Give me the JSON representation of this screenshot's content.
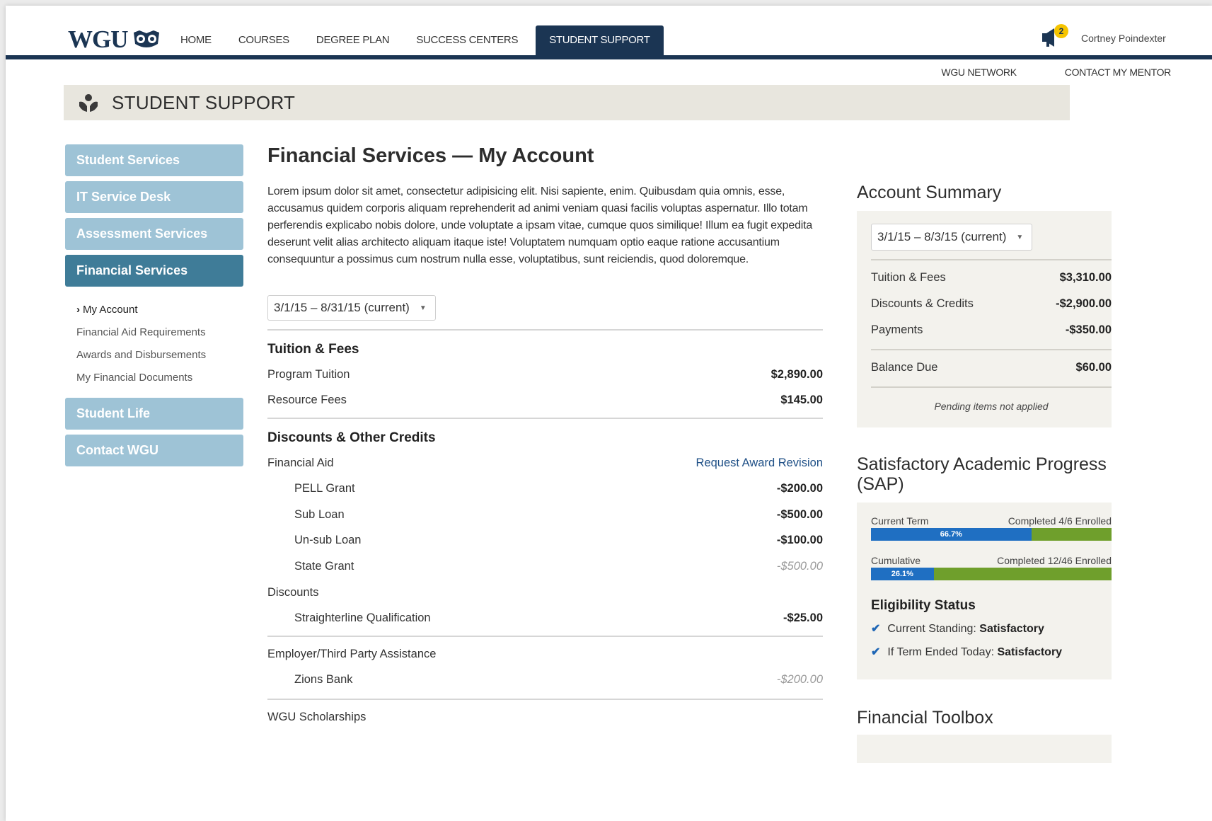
{
  "brand": {
    "logo_text": "WGU"
  },
  "nav": {
    "items": [
      "Home",
      "Courses",
      "Degree Plan",
      "Success Centers"
    ],
    "active": "Student Support"
  },
  "user": {
    "name": "Cortney Poindexter",
    "notification_count": "2"
  },
  "util_links": [
    "WGU Network",
    "Contact My Mentor"
  ],
  "section": {
    "title": "STUDENT SUPPORT"
  },
  "sidebar": {
    "buttons_top": [
      "Student Services",
      "IT Service Desk",
      "Assessment Services"
    ],
    "active": "Financial Services",
    "sub_items": [
      {
        "label": "My Account",
        "current": true
      },
      {
        "label": "Financial Aid Requirements"
      },
      {
        "label": "Awards and Disbursements"
      },
      {
        "label": "My Financial Documents"
      }
    ],
    "buttons_bottom": [
      "Student Life",
      "Contact WGU"
    ]
  },
  "main": {
    "title": "Financial Services — My Account",
    "intro": "Lorem ipsum dolor sit amet, consectetur adipisicing elit. Nisi sapiente, enim. Quibusdam quia omnis, esse, accusamus quidem corporis aliquam reprehenderit ad animi veniam quasi facilis voluptas aspernatur. Illo totam perferendis explicabo nobis dolore, unde voluptate a ipsam vitae, cumque quos similique! Illum ea fugit expedita deserunt velit alias architecto aliquam itaque iste! Voluptatem numquam optio eaque ratione accusantium consequuntur a possimus cum nostrum nulla esse, voluptatibus, sunt reiciendis, quod doloremque.",
    "term_select": "3/1/15 – 8/31/15 (current)",
    "tuition": {
      "title": "Tuition & Fees",
      "rows": [
        {
          "label": "Program Tuition",
          "amount": "$2,890.00"
        },
        {
          "label": "Resource Fees",
          "amount": "$145.00"
        }
      ]
    },
    "discounts": {
      "title": "Discounts & Other Credits",
      "financial_aid_label": "Financial Aid",
      "revision_link": "Request Award Revision",
      "aid_rows": [
        {
          "label": "PELL Grant",
          "amount": "-$200.00"
        },
        {
          "label": "Sub Loan",
          "amount": "-$500.00"
        },
        {
          "label": "Un-sub Loan",
          "amount": "-$100.00"
        },
        {
          "label": "State Grant",
          "amount": "-$500.00",
          "pending": true
        }
      ],
      "discounts_label": "Discounts",
      "discount_rows": [
        {
          "label": "Straighterline Qualification",
          "amount": "-$25.00"
        }
      ]
    },
    "employer": {
      "label": "Employer/Third Party Assistance",
      "rows": [
        {
          "label": "Zions Bank",
          "amount": "-$200.00",
          "pending": true
        }
      ]
    },
    "scholarships_label": "WGU Scholarships"
  },
  "summary": {
    "title": "Account Summary",
    "term_select": "3/1/15 – 8/3/15 (current)",
    "rows": [
      {
        "label": "Tuition & Fees",
        "amount": "$3,310.00"
      },
      {
        "label": "Discounts & Credits",
        "amount": "-$2,900.00"
      },
      {
        "label": "Payments",
        "amount": "-$350.00"
      }
    ],
    "balance": {
      "label": "Balance Due",
      "amount": "$60.00"
    },
    "note": "Pending items not applied"
  },
  "sap": {
    "title": "Satisfactory Academic Progress (SAP)",
    "bars": [
      {
        "label": "Current Term",
        "status": "Completed 4/6 Enrolled",
        "percent": 66.7,
        "percent_label": "66.7%"
      },
      {
        "label": "Cumulative",
        "status": "Completed 12/46 Enrolled",
        "percent": 26.1,
        "percent_label": "26.1%"
      }
    ],
    "eligibility_title": "Eligibility Status",
    "eligibility": [
      {
        "label": "Current Standing:",
        "value": "Satisfactory"
      },
      {
        "label": "If Term Ended Today:",
        "value": "Satisfactory"
      }
    ]
  },
  "toolbox": {
    "title": "Financial Toolbox"
  },
  "colors": {
    "navy": "#1b3553",
    "sidebar_light": "#9ec3d6",
    "sidebar_active": "#3f7c98",
    "bar_blue": "#1f6fc2",
    "bar_green": "#6f9f2c",
    "link": "#1e4f86"
  }
}
